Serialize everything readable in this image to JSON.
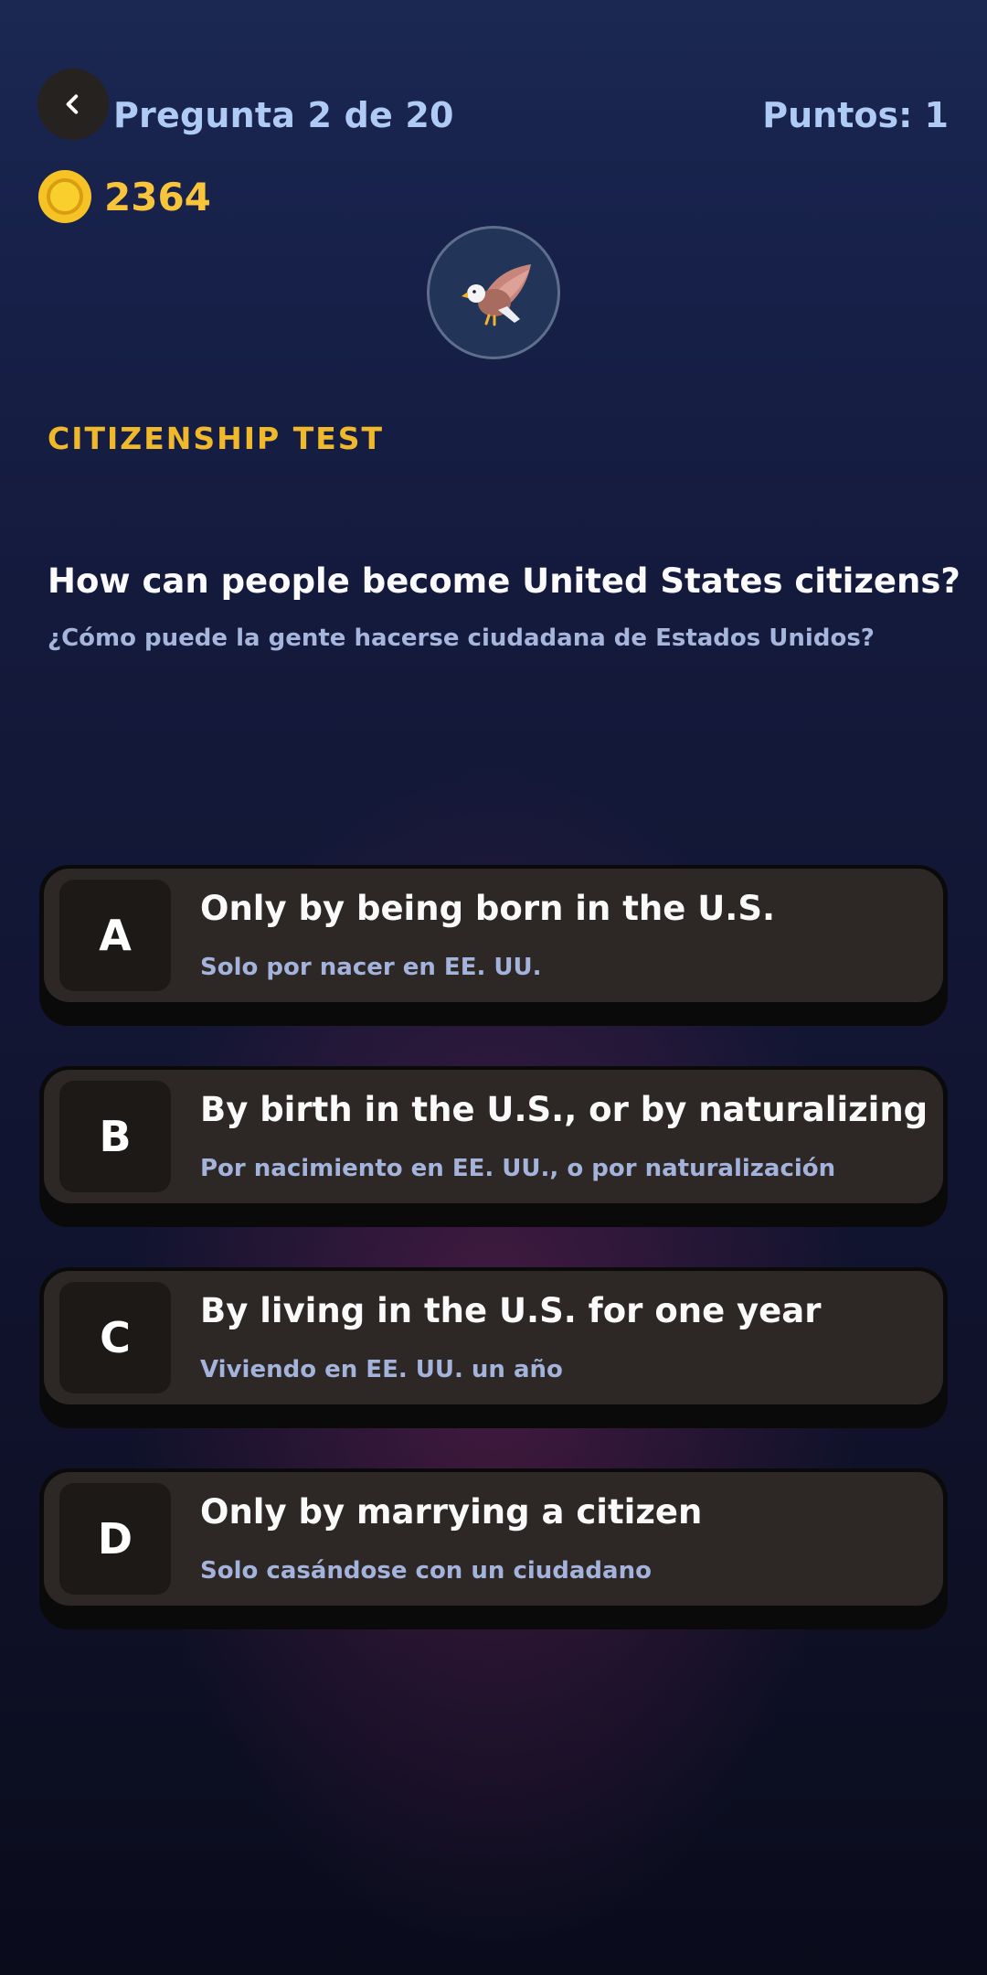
{
  "header": {
    "back_icon": "chevron-left-icon",
    "progress_label": "Pregunta 2 de 20",
    "points_label": "Puntos: 1"
  },
  "coins": {
    "icon": "coin-icon",
    "count": "2364",
    "color": "#f6c326"
  },
  "avatar": {
    "icon": "eagle-icon"
  },
  "category": "CITIZENSHIP TEST",
  "question": {
    "text_en": "How can people become United States citizens?",
    "text_es": "¿Cómo puede la gente hacerse ciudadana de Estados Unidos?"
  },
  "options": [
    {
      "letter": "A",
      "text_en": "Only by being born in the U.S.",
      "text_es": "Solo por nacer en EE. UU."
    },
    {
      "letter": "B",
      "text_en": "By birth in the U.S., or by naturalizing",
      "text_es": "Por nacimiento en EE. UU., o por naturalización"
    },
    {
      "letter": "C",
      "text_en": "By living in the U.S. for one year",
      "text_es": "Viviendo en EE. UU. un año"
    },
    {
      "letter": "D",
      "text_en": "Only by marrying a citizen",
      "text_es": "Solo casándose con un ciudadano"
    }
  ],
  "colors": {
    "accent_gold": "#f0b92c",
    "header_text": "#aecbf5",
    "option_bg": "#2d2826",
    "subtext": "#a4b3dc"
  }
}
